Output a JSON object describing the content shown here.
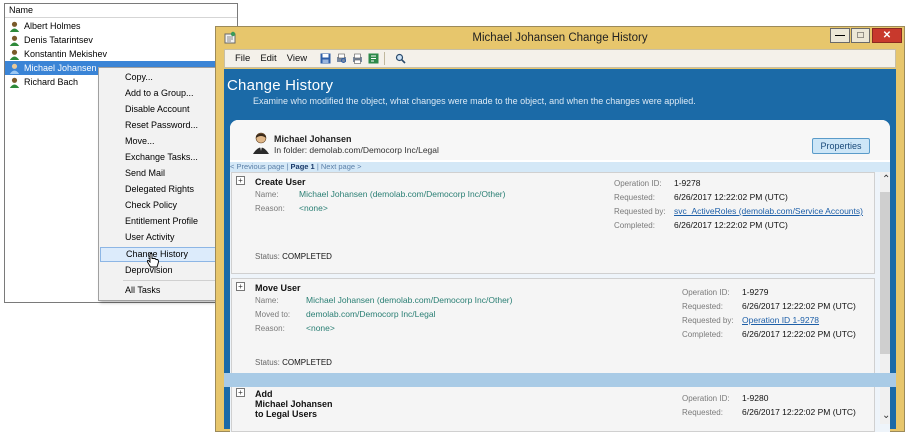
{
  "user_list": {
    "header": "Name",
    "users": [
      "Albert Holmes",
      "Denis Tatarintsev",
      "Konstantin Mekishev",
      "Michael Johansen",
      "Richard Bach"
    ],
    "selected": "Michael Johansen"
  },
  "context_menu": {
    "items": [
      "Copy...",
      "Add to a Group...",
      "Disable Account",
      "Reset Password...",
      "Move...",
      "Exchange Tasks...",
      "Send Mail",
      "Delegated Rights",
      "Check Policy",
      "Entitlement Profile",
      "User Activity",
      "Change History",
      "Deprovision",
      "All Tasks"
    ],
    "highlighted": "Change History"
  },
  "window": {
    "title": "Michael Johansen Change History",
    "menu": [
      "File",
      "Edit",
      "View"
    ],
    "toolbar_icons": [
      "save-icon",
      "print-preview-icon",
      "print-icon",
      "export-icon",
      "search-icon"
    ]
  },
  "change_history": {
    "title": "Change History",
    "subtitle": "Examine who modified the object, what changes were made to the object, and when the changes were applied.",
    "object_name": "Michael Johansen",
    "object_folder": "In folder: demolab.com/Democorp Inc/Legal",
    "properties_label": "Properties",
    "pager": {
      "prev": "< Previous page",
      "sep": " | ",
      "current": "Page 1",
      "next": "Next page >"
    }
  },
  "entries": [
    {
      "title": "Create User",
      "fields": [
        {
          "label": "Name:",
          "value": "Michael Johansen (demolab.com/Democorp Inc/Other)"
        },
        {
          "label": "Reason:",
          "value": "<none>"
        }
      ],
      "status_label": "Status:",
      "status": "COMPLETED",
      "op_label": "Operation ID:",
      "op_id": "1-9278",
      "requested_label": "Requested:",
      "requested": "6/26/2017 12:22:02 PM (UTC)",
      "requested_by_label": "Requested by:",
      "requested_by": "svc_ActiveRoles (demolab.com/Service Accounts)",
      "completed_label": "Completed:",
      "completed": "6/26/2017 12:22:02 PM (UTC)"
    },
    {
      "title": "Move User",
      "fields": [
        {
          "label": "Name:",
          "value": "Michael Johansen (demolab.com/Democorp Inc/Other)"
        },
        {
          "label": "Moved to:",
          "value": "demolab.com/Democorp Inc/Legal"
        },
        {
          "label": "Reason:",
          "value": "<none>"
        }
      ],
      "status_label": "Status:",
      "status": "COMPLETED",
      "op_label": "Operation ID:",
      "op_id": "1-9279",
      "requested_label": "Requested:",
      "requested": "6/26/2017 12:22:02 PM (UTC)",
      "requested_by_label": "Requested by:",
      "requested_by": "Operation ID 1-9278",
      "completed_label": "Completed:",
      "completed": "6/26/2017 12:22:02 PM (UTC)"
    },
    {
      "title_lines": [
        "Add",
        "Michael Johansen",
        "to Legal Users"
      ],
      "op_label": "Operation ID:",
      "op_id": "1-9280",
      "requested_label": "Requested:",
      "requested": "6/26/2017 12:22:02 PM (UTC)"
    }
  ],
  "colors": {
    "accent": "#1b6aa7",
    "title_bar": "#e7c66c",
    "selection": "#3a84d6",
    "value_teal": "#2a7f74",
    "link": "#1d5fa8"
  }
}
